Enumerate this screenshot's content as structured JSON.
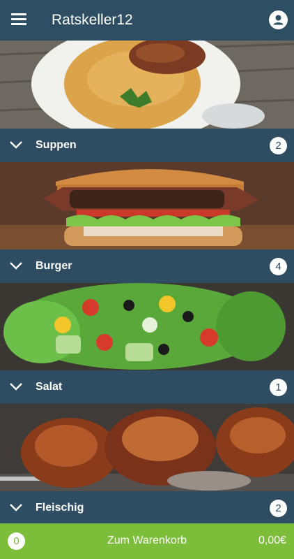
{
  "appbar": {
    "title": "Ratskeller12",
    "menu_icon": "menu-icon",
    "account_icon": "account-icon"
  },
  "categories": [
    {
      "label": "Suppen",
      "count": "2",
      "image": "soup"
    },
    {
      "label": "Burger",
      "count": "4",
      "image": "burger"
    },
    {
      "label": "Salat",
      "count": "1",
      "image": "salad"
    },
    {
      "label": "Fleischig",
      "count": "2",
      "image": "meat"
    }
  ],
  "cart": {
    "count": "0",
    "label": "Zum Warenkorb",
    "total": "0,00€"
  },
  "colors": {
    "primary": "#2e4d62",
    "accent": "#7cbd3a"
  }
}
